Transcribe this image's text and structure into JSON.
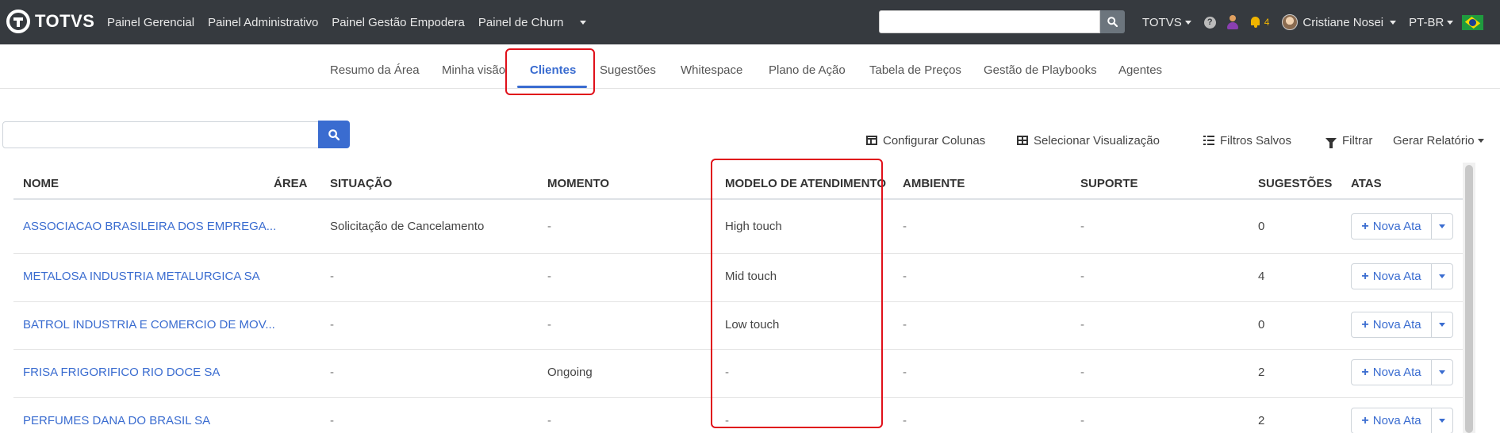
{
  "navbar": {
    "brand": "TOTVS",
    "links": [
      "Painel Gerencial",
      "Painel Administrativo",
      "Painel Gestão Empodera",
      "Painel de Churn"
    ],
    "search_placeholder": "",
    "company": "TOTVS",
    "notifications_count": "4",
    "user_name": "Cristiane Nosei",
    "language": "PT-BR"
  },
  "tabs": [
    {
      "label": "Resumo da Área"
    },
    {
      "label": "Minha visão"
    },
    {
      "label": "Clientes",
      "active": true
    },
    {
      "label": "Sugestões"
    },
    {
      "label": "Whitespace"
    },
    {
      "label": "Plano de Ação"
    },
    {
      "label": "Tabela de Preços"
    },
    {
      "label": "Gestão de Playbooks"
    },
    {
      "label": "Agentes"
    }
  ],
  "toolbar": {
    "search_placeholder": "",
    "configure_columns": "Configurar Colunas",
    "select_view": "Selecionar Visualização",
    "saved_filters": "Filtros Salvos",
    "filter": "Filtrar",
    "generate_report": "Gerar Relatório"
  },
  "table": {
    "columns": [
      "NOME",
      "ÁREA",
      "SITUAÇÃO",
      "MOMENTO",
      "MODELO DE ATENDIMENTO",
      "AMBIENTE",
      "SUPORTE",
      "SUGESTÕES",
      "ATAS"
    ],
    "new_ata_label": "Nova Ata",
    "rows": [
      {
        "nome": "ASSOCIACAO BRASILEIRA DOS EMPREGA...",
        "area": "",
        "situacao": "Solicitação de Cancelamento",
        "momento": "-",
        "modelo": "High touch",
        "ambiente": "-",
        "suporte": "-",
        "sugestoes": "0"
      },
      {
        "nome": "METALOSA INDUSTRIA METALURGICA SA",
        "area": "",
        "situacao": "-",
        "momento": "-",
        "modelo": "Mid touch",
        "ambiente": "-",
        "suporte": "-",
        "sugestoes": "4"
      },
      {
        "nome": "BATROL INDUSTRIA E COMERCIO DE MOV...",
        "area": "",
        "situacao": "-",
        "momento": "-",
        "modelo": "Low touch",
        "ambiente": "-",
        "suporte": "-",
        "sugestoes": "0"
      },
      {
        "nome": "FRISA FRIGORIFICO RIO DOCE SA",
        "area": "",
        "situacao": "-",
        "momento": "Ongoing",
        "modelo": "-",
        "ambiente": "-",
        "suporte": "-",
        "sugestoes": "2"
      },
      {
        "nome": "PERFUMES DANA DO BRASIL SA",
        "area": "",
        "situacao": "-",
        "momento": "-",
        "modelo": "-",
        "ambiente": "-",
        "suporte": "-",
        "sugestoes": "2"
      }
    ]
  },
  "colors": {
    "navbar_bg": "#363a3f",
    "accent": "#3a6cd0",
    "highlight": "#e0101a"
  }
}
